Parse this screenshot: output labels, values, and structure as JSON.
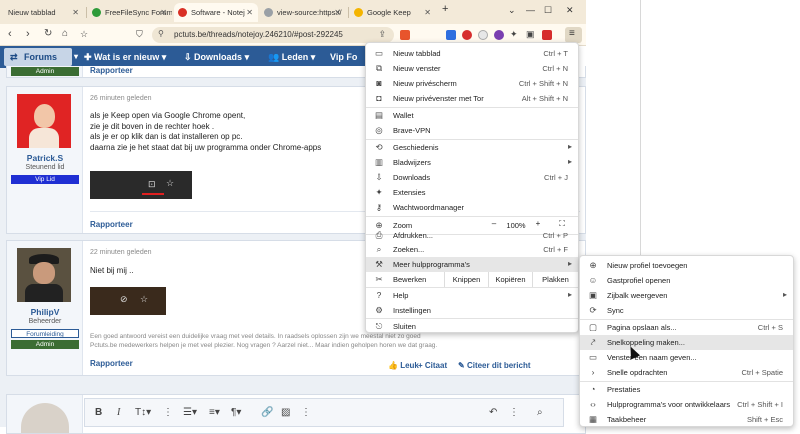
{
  "tabs": [
    {
      "label": "Nieuw tabblad",
      "color": "#ffffff"
    },
    {
      "label": "FreeFileSync Forum",
      "color": "#2e9b3a"
    },
    {
      "label": "Software - Notej",
      "color": "#d93025"
    },
    {
      "label": "view-source:https://",
      "color": "#9aa0a6"
    },
    {
      "label": "Google Keep",
      "color": "#f4b400"
    }
  ],
  "toolbar": {
    "url": "pctuts.be/threads/notejoy.246210/#post-292245"
  },
  "forum_nav": {
    "forums": "Forums",
    "items": [
      "Wat is er nieuw",
      "Downloads",
      "Leden",
      "Vip Fo"
    ]
  },
  "posts": {
    "top_badge": "Admin",
    "top_rapporteer": "Rapporteer",
    "post1": {
      "time": "26 minuten geleden",
      "name": "Patrick.S",
      "role": "Steunend lid",
      "badge": "Vip Lid",
      "lines": [
        "als je Keep open via Google Chrome opent,",
        "zie je dit boven in de rechter hoek .",
        "als je er op klik dan is dat installeren op pc.",
        "daarna zie je het staat dat bij uw programma onder Chrome-apps"
      ],
      "rapporteer": "Rapporteer"
    },
    "post2": {
      "time": "22 minuten geleden",
      "name": "PhilipV",
      "role": "Beheerder",
      "badge1": "Forumleiding",
      "badge2": "Admin",
      "text": "Niet bij mij ..",
      "sig1": "Een goed antwoord vereist een duidelijke vraag met veel details. In raadsels oplossen zijn we meestal niet zo goed",
      "sig2": "Pctuts.be medewerkers helpen je met veel plezier. Nog vragen ? Aarzel niet... Maar indien geholpen horen we dat graag.",
      "rapporteer": "Rapporteer",
      "like": "Leuk",
      "citaat": "+ Citaat",
      "citeer": "Citeer dit bericht"
    }
  },
  "menu": {
    "new_tab": {
      "label": "Nieuw tabblad",
      "shortcut": "Ctrl + T"
    },
    "new_window": {
      "label": "Nieuw venster",
      "shortcut": "Ctrl + N"
    },
    "private": {
      "label": "Nieuw privéscherm",
      "shortcut": "Ctrl + Shift + N"
    },
    "private_tor": {
      "label": "Nieuw privévenster met Tor",
      "shortcut": "Alt + Shift + N"
    },
    "wallet": "Wallet",
    "vpn": "Brave-VPN",
    "history": "Geschiedenis",
    "bookmarks": "Bladwijzers",
    "downloads": {
      "label": "Downloads",
      "shortcut": "Ctrl + J"
    },
    "extensions": "Extensies",
    "passwords": "Wachtwoordmanager",
    "zoom": {
      "label": "Zoom",
      "minus": "–",
      "value": "100%",
      "plus": "+"
    },
    "print": {
      "label": "Afdrukken...",
      "shortcut": "Ctrl + P"
    },
    "find": {
      "label": "Zoeken...",
      "shortcut": "Ctrl + F"
    },
    "more_tools": "Meer hulpprogramma's",
    "edit": {
      "label": "Bewerken",
      "cut": "Knippen",
      "copy": "Kopiëren",
      "paste": "Plakken"
    },
    "help": "Help",
    "settings": "Instellingen",
    "exit": "Sluiten"
  },
  "submenu": {
    "new_profile": "Nieuw profiel toevoegen",
    "guest": "Gastprofiel openen",
    "sidebar": "Zijbalk weergeven",
    "sync": "Sync",
    "save_page": {
      "label": "Pagina opslaan als...",
      "shortcut": "Ctrl + S"
    },
    "shortcut": "Snelkoppeling maken...",
    "name_window": "Venster een naam geven...",
    "quick_cmds": {
      "label": "Snelle opdrachten",
      "shortcut": "Ctrl + Spatie"
    },
    "performance": "Prestaties",
    "devtools": {
      "label": "Hulpprogramma's voor ontwikkelaars",
      "shortcut": "Ctrl + Shift + I"
    },
    "taskmgr": {
      "label": "Taakbeheer",
      "shortcut": "Shift + Esc"
    }
  }
}
